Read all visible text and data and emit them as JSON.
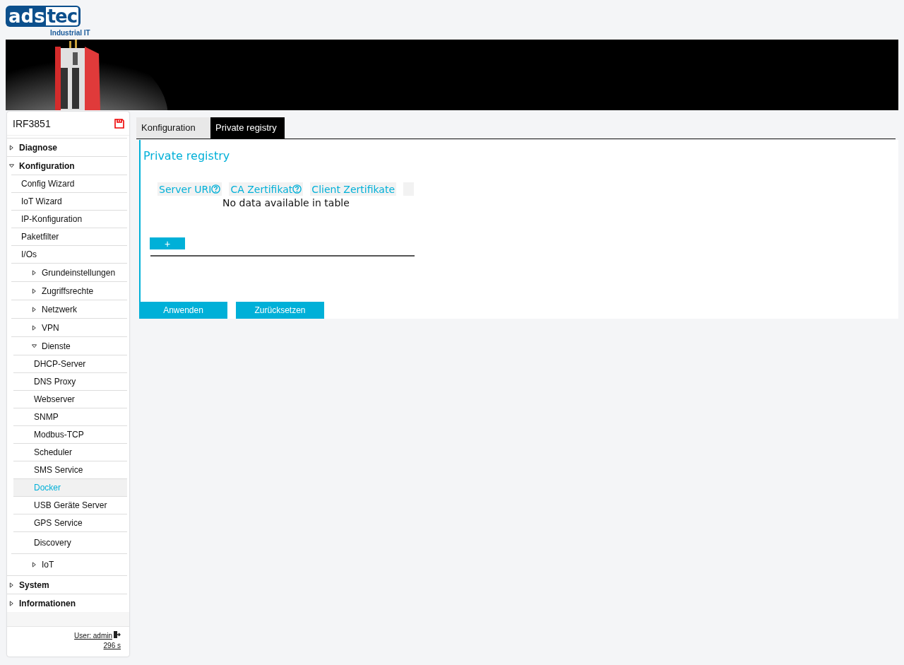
{
  "logo": {
    "part_1": "ads",
    "part_2": "tec",
    "tagline": "Industrial IT"
  },
  "banner": {
    "kind": "picture"
  },
  "sidebar": {
    "device": "IRF3851",
    "items": [
      {
        "label": "Diagnose",
        "kind": "group",
        "expanded": false
      },
      {
        "label": "Konfiguration",
        "kind": "group",
        "expanded": true,
        "children": [
          {
            "label": "Config Wizard",
            "kind": "link",
            "selected": false
          },
          {
            "label": "IoT Wizard",
            "kind": "link",
            "selected": false
          },
          {
            "label": "IP-Konfiguration",
            "kind": "link",
            "selected": false
          },
          {
            "label": "Paketfilter",
            "kind": "link",
            "selected": false
          },
          {
            "label": "I/Os",
            "kind": "link",
            "selected": false
          },
          {
            "label": "Grundeinstellungen",
            "kind": "section",
            "expanded": false
          },
          {
            "label": "Zugriffsrechte",
            "kind": "section",
            "expanded": false
          },
          {
            "label": "Netzwerk",
            "kind": "section",
            "expanded": false
          },
          {
            "label": "VPN",
            "kind": "section",
            "expanded": false
          },
          {
            "label": "Dienste",
            "kind": "section",
            "expanded": true,
            "children": [
              {
                "label": "DHCP-Server",
                "kind": "link",
                "selected": false
              },
              {
                "label": "DNS Proxy",
                "kind": "link",
                "selected": false
              },
              {
                "label": "Webserver",
                "kind": "link",
                "selected": false
              },
              {
                "label": "SNMP",
                "kind": "link",
                "selected": false
              },
              {
                "label": "Modbus-TCP",
                "kind": "link",
                "selected": false
              },
              {
                "label": "Scheduler",
                "kind": "link",
                "selected": false
              },
              {
                "label": "SMS Service",
                "kind": "link",
                "selected": false
              },
              {
                "label": "Docker",
                "kind": "link",
                "selected": true
              },
              {
                "label": "USB Geräte Server",
                "kind": "link",
                "selected": false
              },
              {
                "label": "GPS Service",
                "kind": "link",
                "selected": false
              },
              {
                "label": "Discovery",
                "kind": "link",
                "selected": false
              }
            ]
          },
          {
            "label": "IoT",
            "kind": "section",
            "expanded": false
          }
        ]
      },
      {
        "label": "System",
        "kind": "group",
        "expanded": false
      },
      {
        "label": "Informationen",
        "kind": "group",
        "expanded": false
      }
    ],
    "user": "User: admin",
    "timer": "296 s"
  },
  "tabs": [
    {
      "label": "Konfiguration",
      "selected": false
    },
    {
      "label": "Private registry",
      "selected": true
    }
  ],
  "panel": {
    "title": "Private registry",
    "columns": [
      {
        "label": "Server URI",
        "help": true
      },
      {
        "label": "CA Zertifikat",
        "help": true
      },
      {
        "label": "Client Zertifikate",
        "help": false
      }
    ],
    "empty_message": "No data available in table",
    "add_button": "+"
  },
  "buttons": [
    "Anwenden",
    "Zurücksetzen"
  ]
}
